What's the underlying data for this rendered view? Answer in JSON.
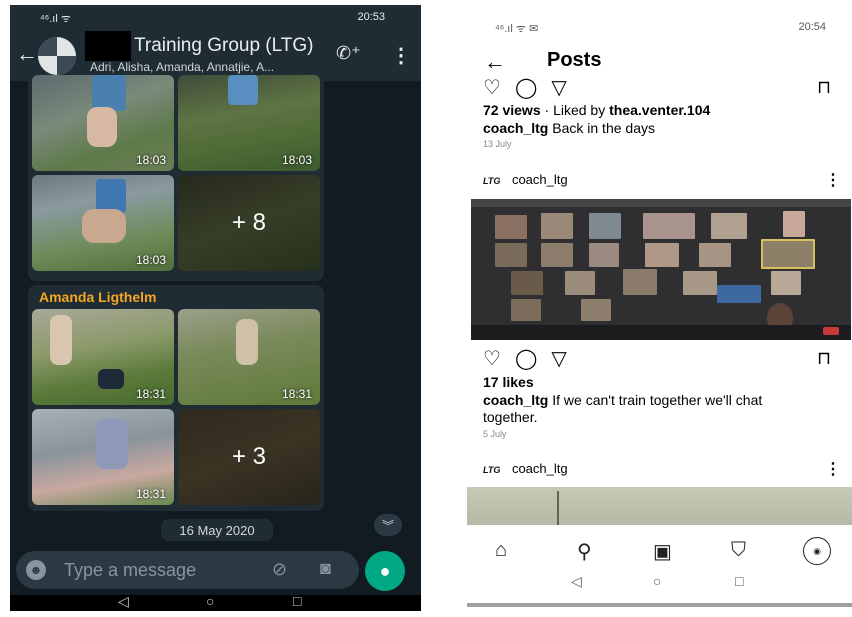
{
  "whatsapp": {
    "status_left": "⁴⁶.ıl ᯤ",
    "status_right": "20:53",
    "group_title": "Training Group (LTG)",
    "members": "Adri, Alisha, Amanda, Annatjie, A...",
    "first_group": {
      "times": [
        "18:03",
        "18:03",
        "18:03"
      ],
      "more_count": "+ 8"
    },
    "sender": "Amanda Ligthelm",
    "second_group": {
      "times": [
        "18:31",
        "18:31",
        "18:31"
      ],
      "more_count": "+ 3"
    },
    "date_chip": "16 May 2020",
    "composer_placeholder": "Type a message",
    "icons": [
      "back-arrow-icon",
      "add-call-icon",
      "more-vertical-icon",
      "emoji-icon",
      "attach-icon",
      "camera-icon",
      "mic-icon",
      "scroll-down-icon"
    ],
    "colors": {
      "header": "#1f2c34",
      "background": "#121b22",
      "accent": "#00a884",
      "sender": "#f5a623"
    }
  },
  "instagram": {
    "status_left": "⁴⁶.ıl ᯤ ✉",
    "status_right": "20:54",
    "header_title": "Posts",
    "post1": {
      "views": "72 views",
      "liked_by_prefix": "Liked by ",
      "liked_by_user": "thea.venter.104",
      "caption_user": "coach_ltg",
      "caption": "Back in the days",
      "date": "13 July"
    },
    "post2": {
      "logo_text": "LTG",
      "username": "coach_ltg",
      "likes": "17 likes",
      "caption_user": "coach_ltg",
      "caption_line1": "If we can't train together we'll chat",
      "caption_line2": "together.",
      "date": "5 July"
    },
    "post3": {
      "logo_text": "LTG",
      "username": "coach_ltg"
    },
    "icons": [
      "back-arrow-icon",
      "heart-icon",
      "comment-icon",
      "share-icon",
      "bookmark-icon",
      "home-icon",
      "search-icon",
      "reels-icon",
      "shop-icon",
      "profile-avatar-icon"
    ],
    "colors": {
      "text": "#000000",
      "muted": "#888888"
    }
  }
}
